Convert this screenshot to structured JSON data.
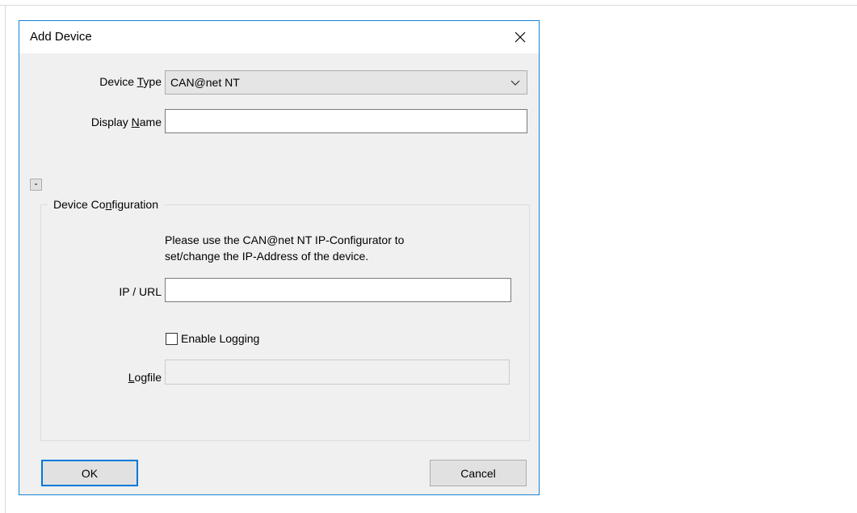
{
  "dialog": {
    "title": "Add Device",
    "close_symbol": "✕"
  },
  "device_type": {
    "label_before": "Device ",
    "label_mnemonic": "T",
    "label_after": "ype",
    "value": "CAN@net NT",
    "dropdown_icon": "chevron-down-icon"
  },
  "display_name": {
    "label_before": "Display ",
    "label_mnemonic": "N",
    "label_after": "ame",
    "value": ""
  },
  "collapse_button": {
    "symbol": "-"
  },
  "device_configuration": {
    "title_before": "Device Co",
    "title_mnemonic": "n",
    "title_after": "figuration",
    "info_line1": "Please use the CAN@net NT IP-Configurator to",
    "info_line2": "set/change the IP-Address of the device.",
    "ip_label": "IP / URL",
    "ip_value": "",
    "logging_label": "Enable Logging",
    "logging_checked": false,
    "logfile_label_mnemonic": "L",
    "logfile_label_after": "ogfile",
    "logfile_value": ""
  },
  "buttons": {
    "ok": "OK",
    "cancel": "Cancel"
  },
  "colors": {
    "dialog_border": "#1883d7",
    "default_button_border": "#0078d7",
    "dialog_background": "#f0f0f0"
  }
}
